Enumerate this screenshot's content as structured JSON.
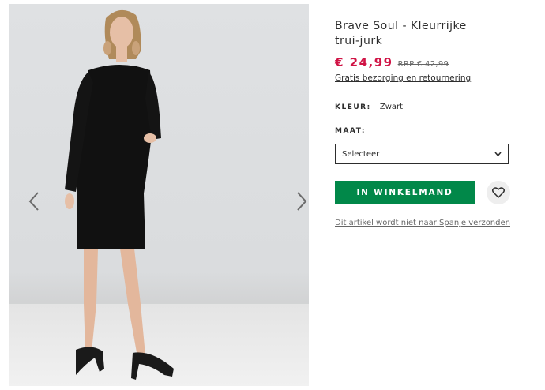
{
  "product": {
    "title": "Brave Soul - Kleurrijke trui-jurk",
    "price": "€ 24,99",
    "rrp": "RRP € 42,99",
    "delivery_link": "Gratis bezorging en retournering",
    "colour_label": "KLEUR:",
    "colour_value": "Zwart",
    "size_label": "MAAT:",
    "size_select_value": "Selecteer",
    "add_to_bag_label": "IN WINKELMAND",
    "shipping_note": "Dit artikel wordt niet naar Spanje verzonden"
  },
  "colors": {
    "price": "#d01345",
    "add_button": "#018849"
  },
  "icons": {
    "prev": "chevron-left-icon",
    "next": "chevron-right-icon",
    "select": "chevron-down-icon",
    "save": "heart-icon"
  }
}
